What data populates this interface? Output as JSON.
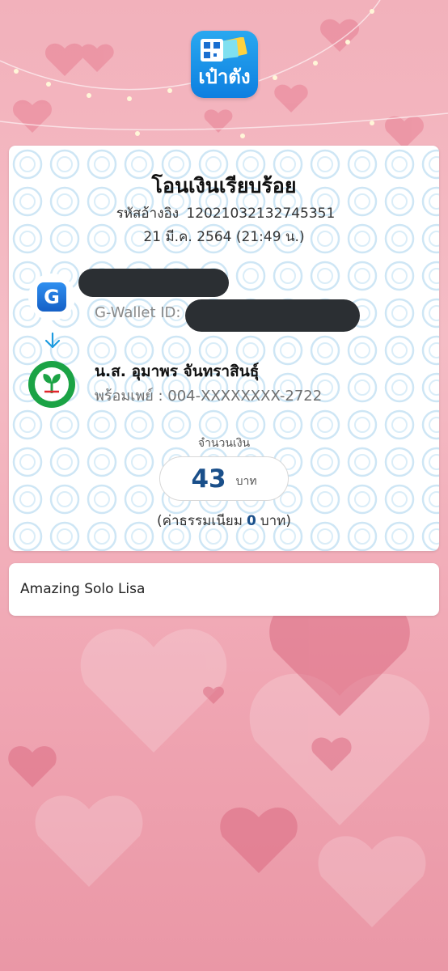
{
  "app": {
    "logo_text": "เป๋าตัง"
  },
  "receipt": {
    "title": "โอนเงินเรียบร้อย",
    "ref_label": "รหัสอ้างอิง",
    "ref_number": "12021032132745351",
    "datetime": "21 มี.ค. 2564 (21:49 น.)",
    "sender": {
      "icon_letter": "G",
      "wallet_label": "G-Wallet ID:"
    },
    "receiver": {
      "name": "น.ส. อุมาพร จันทราสินธุ์",
      "promptpay": "พร้อมเพย์ : 004-XXXXXXXX-2722"
    },
    "amount_label": "จำนวนเงิน",
    "amount": "43",
    "amount_unit": "บาท",
    "fee_prefix": "(ค่าธรรมเนียม",
    "fee_value": "0",
    "fee_suffix": "บาท)"
  },
  "memo": {
    "text": "Amazing Solo Lisa"
  },
  "colors": {
    "background": "#f2b1bb",
    "amount": "#1a4f8a",
    "kbank_green": "#1ba345",
    "app_blue": "#0d7fe0"
  }
}
